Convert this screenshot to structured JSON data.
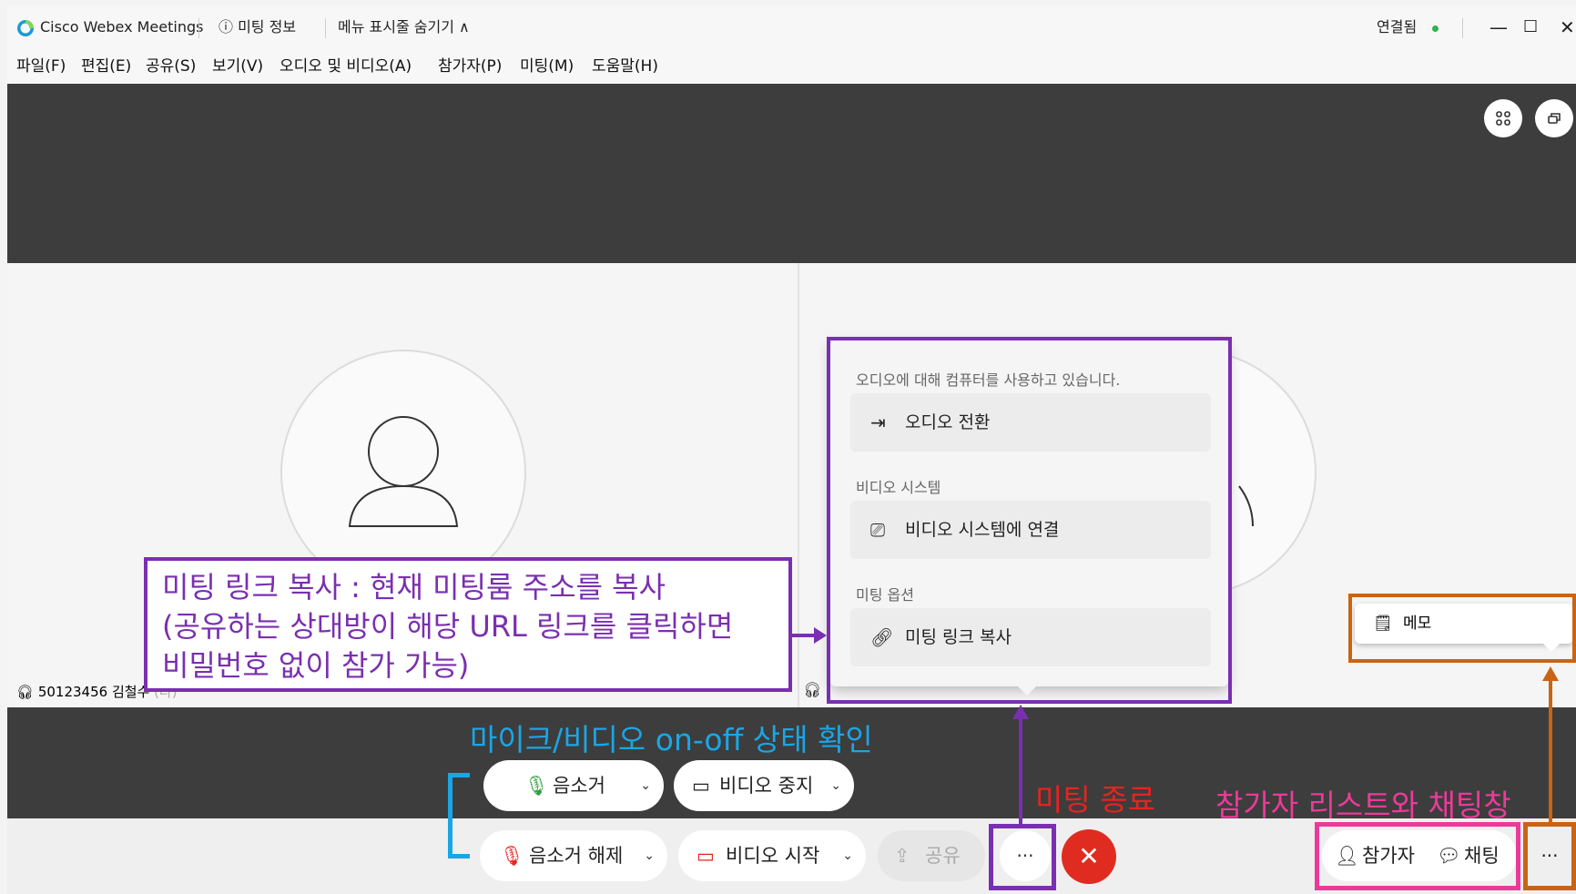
{
  "app": {
    "title": "Cisco Webex Meetings",
    "meeting_info": "ⓘ 미팅 정보",
    "hide_menu": "메뉴 표시줄 숨기기 ∧",
    "status": "연결됨",
    "status_color": "#2eb34d"
  },
  "menu": [
    "파일(F)",
    "편집(E)",
    "공유(S)",
    "보기(V)",
    "오디오 및 비디오(A)",
    "참가자(P)",
    "미팅(M)",
    "도움말(H)"
  ],
  "participant_left": {
    "label": "50123456 김철수",
    "suffix": "(나)"
  },
  "popup": {
    "audio_section": "오디오에 대해 컴퓨터를 사용하고 있습니다.",
    "audio_switch": "오디오 전환",
    "video_section": "비디오 시스템",
    "video_connect": "비디오 시스템에 연결",
    "options_section": "미팅 옵션",
    "copy_link": "미팅 링크 복사"
  },
  "memo_label": "메모",
  "controls_top": {
    "mute": "음소거",
    "stop_video": "비디오 중지"
  },
  "controls": {
    "unmute": "음소거 해제",
    "start_video": "비디오 시작",
    "share": "공유",
    "more": "···",
    "participants": "참가자",
    "chat": "채팅",
    "more_right": "···"
  },
  "annotations": {
    "copy_link_title": "미팅 링크 복사 : 현재 미팅룸 주소를 복사",
    "copy_link_line2": "(공유하는 상대방이 해당 URL 링크를 클릭하면",
    "copy_link_line3": "비밀번호 없이 참가 가능)",
    "mic_video_status": "마이크/비디오 on-off 상태 확인",
    "end_meeting": "미팅 종료",
    "participants_chat": "참가자 리스트와 채팅창"
  },
  "colors": {
    "purple": "#7a2fb0",
    "orange": "#c96414",
    "pink": "#ec3a9a",
    "cyan": "#1aa6e6",
    "red": "#e8231f",
    "end_button": "#e02c20",
    "dark_stage": "#3d3d3d"
  },
  "icons": [
    "webex-logo-icon",
    "info-icon",
    "minimize-icon",
    "maximize-icon",
    "close-icon",
    "grid-view-icon",
    "popout-icon",
    "headset-icon",
    "audio-switch-icon",
    "cast-icon",
    "link-icon",
    "memo-icon",
    "mic-icon",
    "video-icon",
    "share-icon",
    "participants-icon",
    "chat-icon"
  ]
}
